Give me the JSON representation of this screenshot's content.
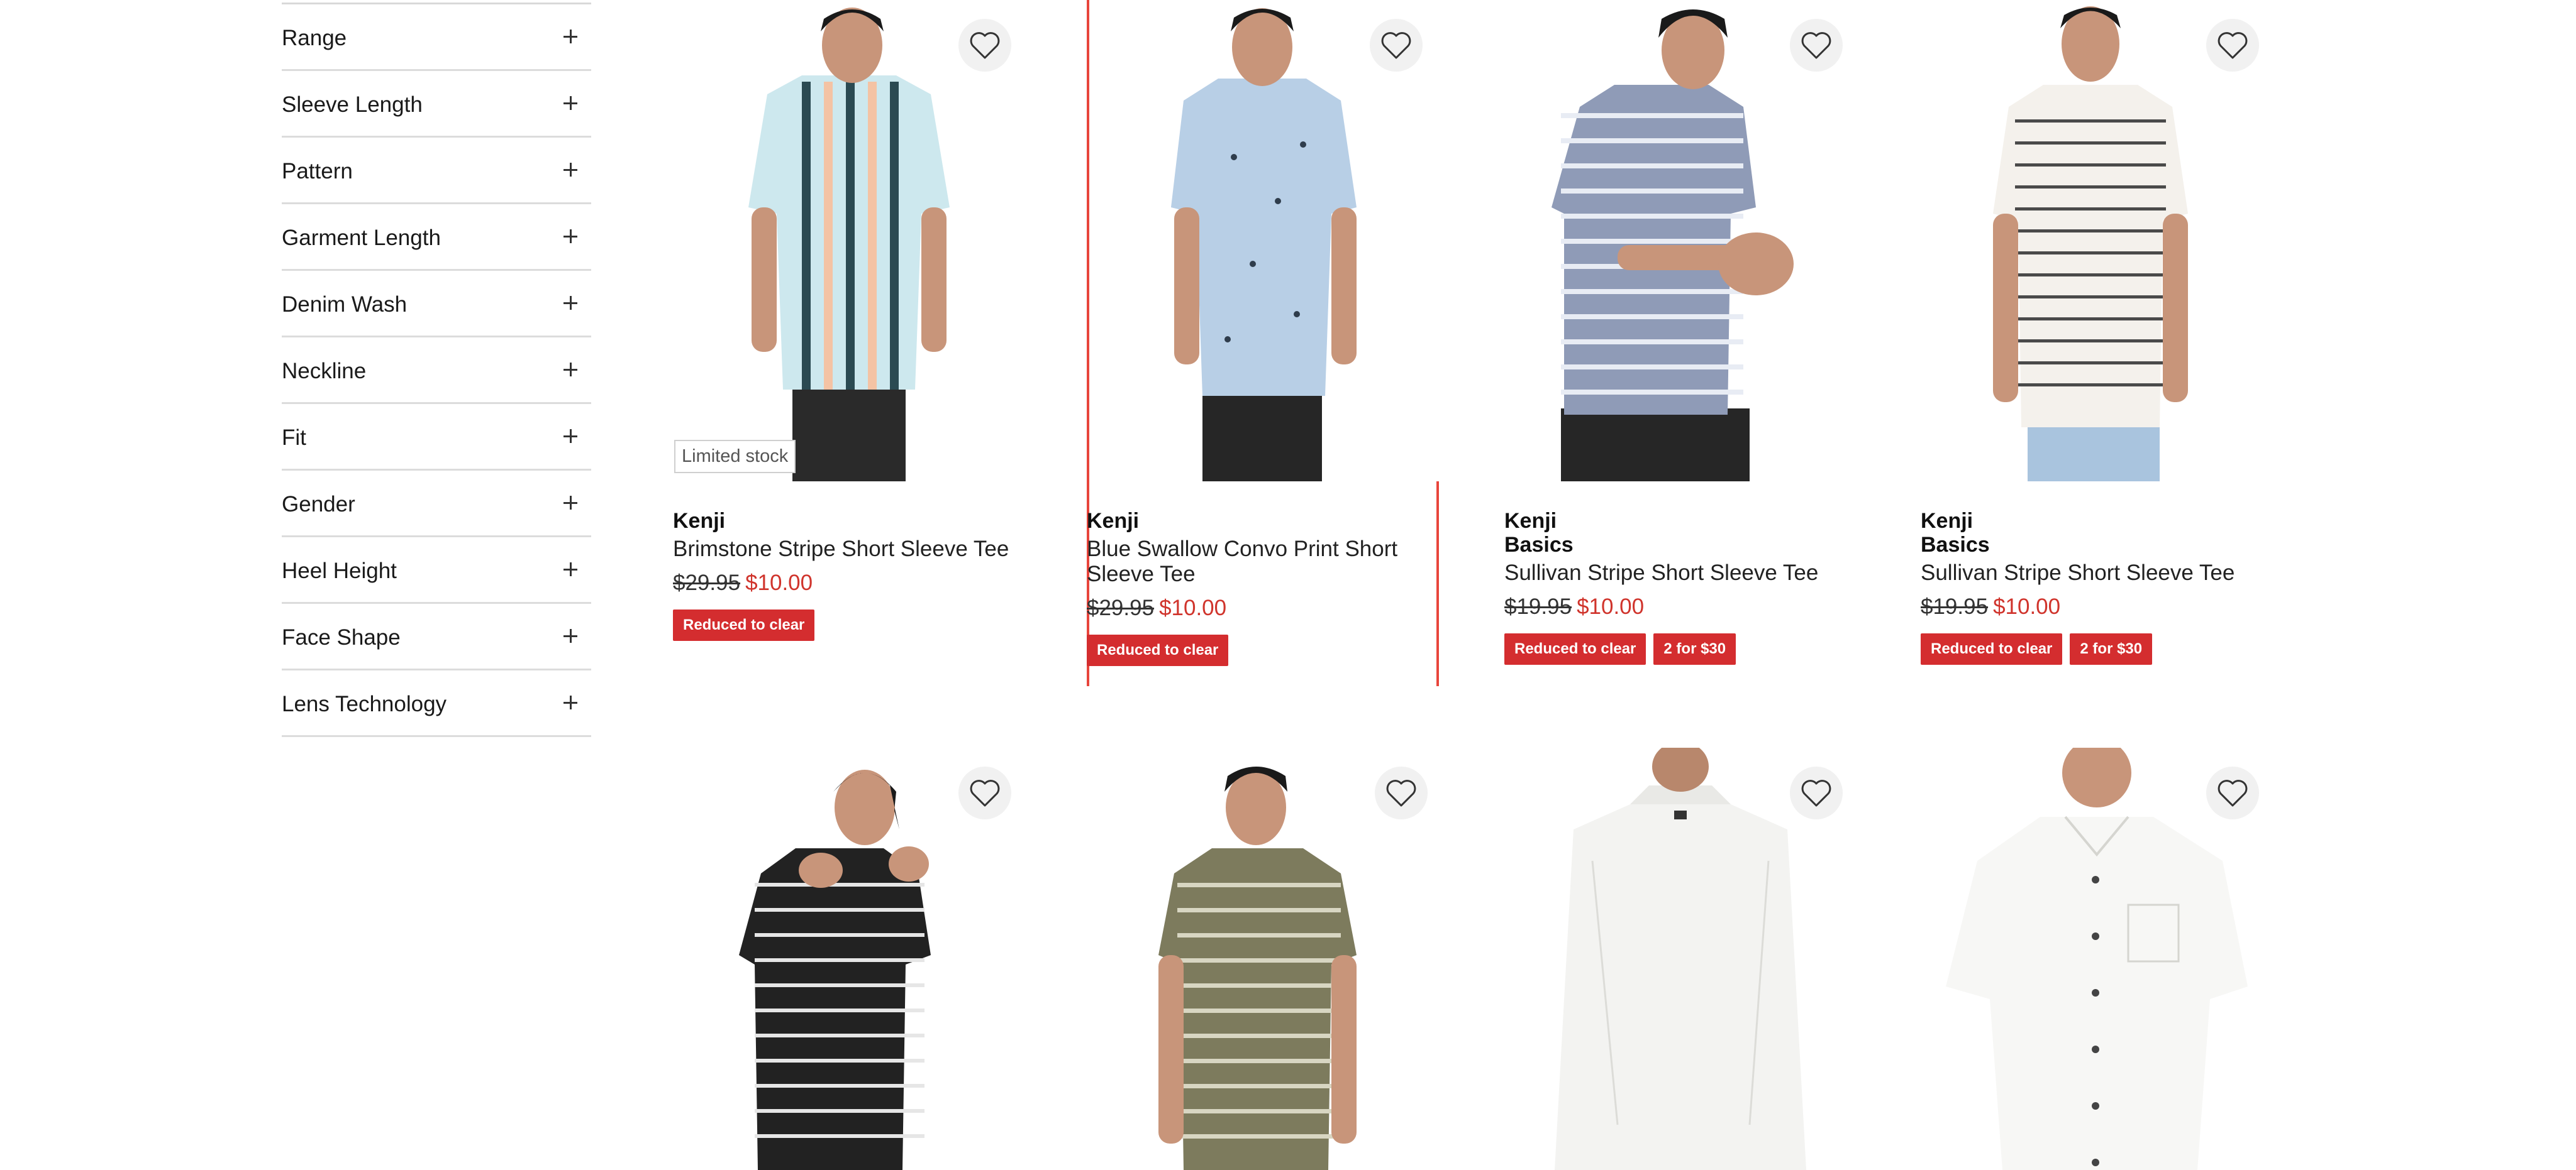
{
  "filters": {
    "items": [
      {
        "label": "Range"
      },
      {
        "label": "Sleeve Length"
      },
      {
        "label": "Pattern"
      },
      {
        "label": "Garment Length"
      },
      {
        "label": "Denim Wash"
      },
      {
        "label": "Neckline"
      },
      {
        "label": "Fit"
      },
      {
        "label": "Gender"
      },
      {
        "label": "Heel Height"
      },
      {
        "label": "Face Shape"
      },
      {
        "label": "Lens Technology"
      }
    ],
    "expand_icon": "plus-icon"
  },
  "wishlist_icon": "heart-outline-icon",
  "colors": {
    "sale_price": "#d0342c",
    "badge_bg": "#d42d2f",
    "highlight_border": "#e8453c"
  },
  "products": [
    {
      "brand": "Kenji",
      "name": "Brimstone Stripe Short Sleeve Tee",
      "was": "$29.95",
      "now": "$10.00",
      "stock_label": "Limited stock",
      "badges": [
        "Reduced to clear"
      ]
    },
    {
      "brand": "Kenji",
      "name": "Blue Swallow Convo Print Short Sleeve Tee",
      "was": "$29.95",
      "now": "$10.00",
      "badges": [
        "Reduced to clear"
      ]
    },
    {
      "brand": "Kenji Basics",
      "name": "Sullivan Stripe Short Sleeve Tee",
      "was": "$19.95",
      "now": "$10.00",
      "badges": [
        "Reduced to clear",
        "2 for $30"
      ]
    },
    {
      "brand": "Kenji Basics",
      "name": "Sullivan Stripe Short Sleeve Tee",
      "was": "$19.95",
      "now": "$10.00",
      "badges": [
        "Reduced to clear",
        "2 for $30"
      ]
    },
    {},
    {},
    {},
    {}
  ]
}
